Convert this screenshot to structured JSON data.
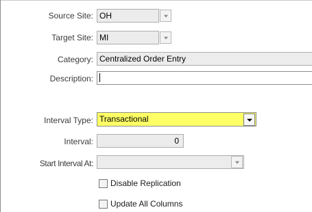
{
  "form": {
    "source_site": {
      "label": "Source Site:",
      "value": "OH"
    },
    "target_site": {
      "label": "Target Site:",
      "value": "MI"
    },
    "category": {
      "label": "Category:",
      "value": "Centralized Order Entry"
    },
    "description": {
      "label": "Description:",
      "value": ""
    },
    "interval_type": {
      "label": "Interval Type:",
      "value": "Transactional"
    },
    "interval": {
      "label": "Interval:",
      "value": "0"
    },
    "start_interval_at": {
      "label": "Start Interval At:",
      "value": ""
    },
    "disable_replication": {
      "label": "Disable Replication",
      "checked": false
    },
    "update_all_columns": {
      "label": "Update All Columns",
      "checked": false
    }
  },
  "colors": {
    "highlight": "#ffff66",
    "disabled_field": "#ececec"
  },
  "icons": {
    "dropdown": "chevron-down-icon"
  }
}
